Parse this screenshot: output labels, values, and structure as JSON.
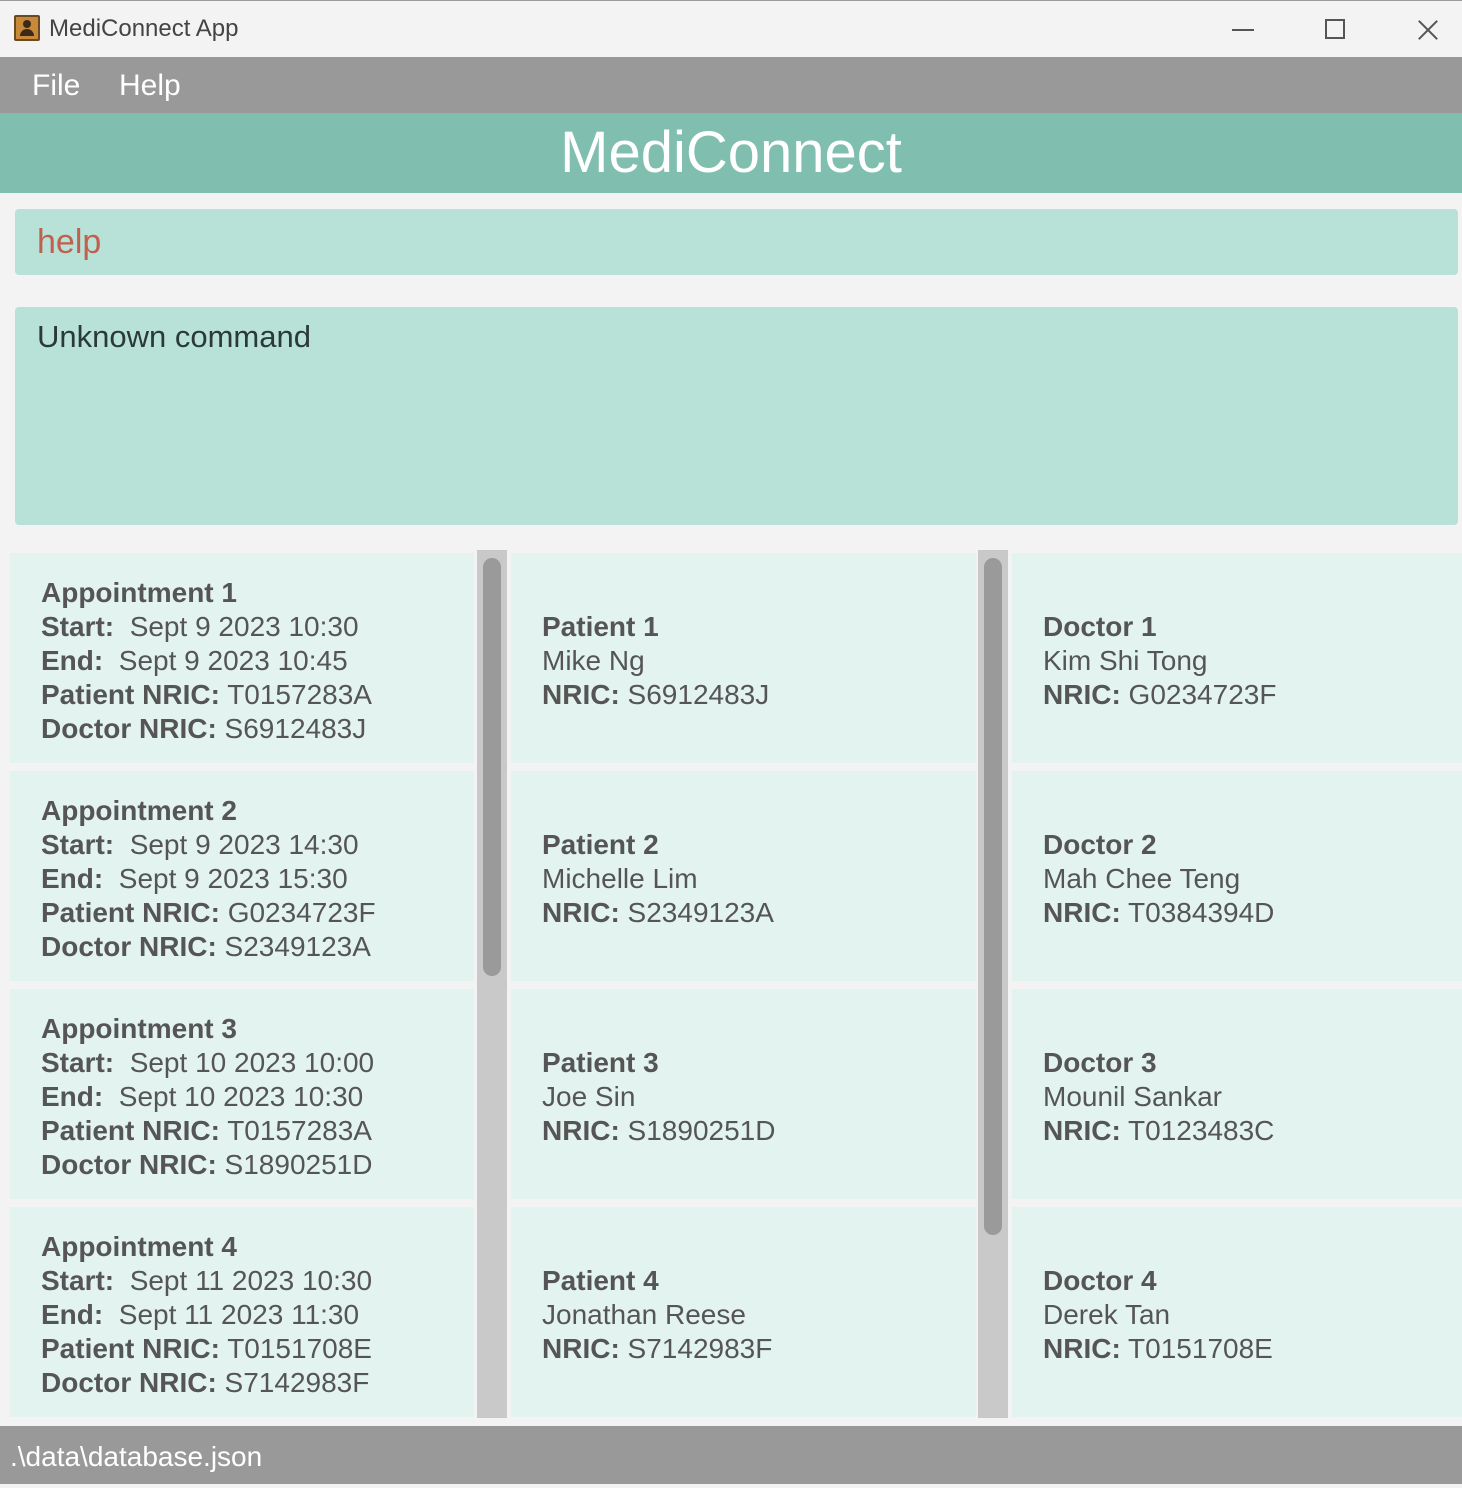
{
  "window": {
    "title": "MediConnect App"
  },
  "menu": {
    "file": "File",
    "help": "Help"
  },
  "header": {
    "title": "MediConnect"
  },
  "command": {
    "value": "help"
  },
  "result": {
    "text": "Unknown command"
  },
  "labels": {
    "start": "Start:",
    "end": "End:",
    "patient_nric": "Patient NRIC:",
    "doctor_nric": "Doctor NRIC:",
    "nric": "NRIC:"
  },
  "appointments": [
    {
      "title": "Appointment 1",
      "start": "Sept 9 2023 10:30",
      "end": "Sept 9 2023 10:45",
      "patient_nric": "T0157283A",
      "doctor_nric": "S6912483J"
    },
    {
      "title": "Appointment 2",
      "start": "Sept 9 2023 14:30",
      "end": "Sept 9 2023 15:30",
      "patient_nric": "G0234723F",
      "doctor_nric": "S2349123A"
    },
    {
      "title": "Appointment 3",
      "start": "Sept 10 2023 10:00",
      "end": "Sept 10 2023 10:30",
      "patient_nric": "T0157283A",
      "doctor_nric": "S1890251D"
    },
    {
      "title": "Appointment 4",
      "start": "Sept 11 2023 10:30",
      "end": "Sept 11 2023 11:30",
      "patient_nric": "T0151708E",
      "doctor_nric": "S7142983F"
    }
  ],
  "patients": [
    {
      "title": "Patient 1",
      "name": "Mike Ng",
      "nric": "S6912483J"
    },
    {
      "title": "Patient 2",
      "name": "Michelle Lim",
      "nric": "S2349123A"
    },
    {
      "title": "Patient 3",
      "name": "Joe Sin",
      "nric": "S1890251D"
    },
    {
      "title": "Patient 4",
      "name": "Jonathan Reese",
      "nric": "S7142983F"
    }
  ],
  "doctors": [
    {
      "title": "Doctor 1",
      "name": "Kim Shi Tong",
      "nric": "G0234723F"
    },
    {
      "title": "Doctor 2",
      "name": "Mah Chee Teng",
      "nric": "T0384394D"
    },
    {
      "title": "Doctor 3",
      "name": "Mounil Sankar",
      "nric": "T0123483C"
    },
    {
      "title": "Doctor 4",
      "name": "Derek Tan",
      "nric": "T0151708E"
    }
  ],
  "status": {
    "path": ".\\data\\database.json"
  }
}
